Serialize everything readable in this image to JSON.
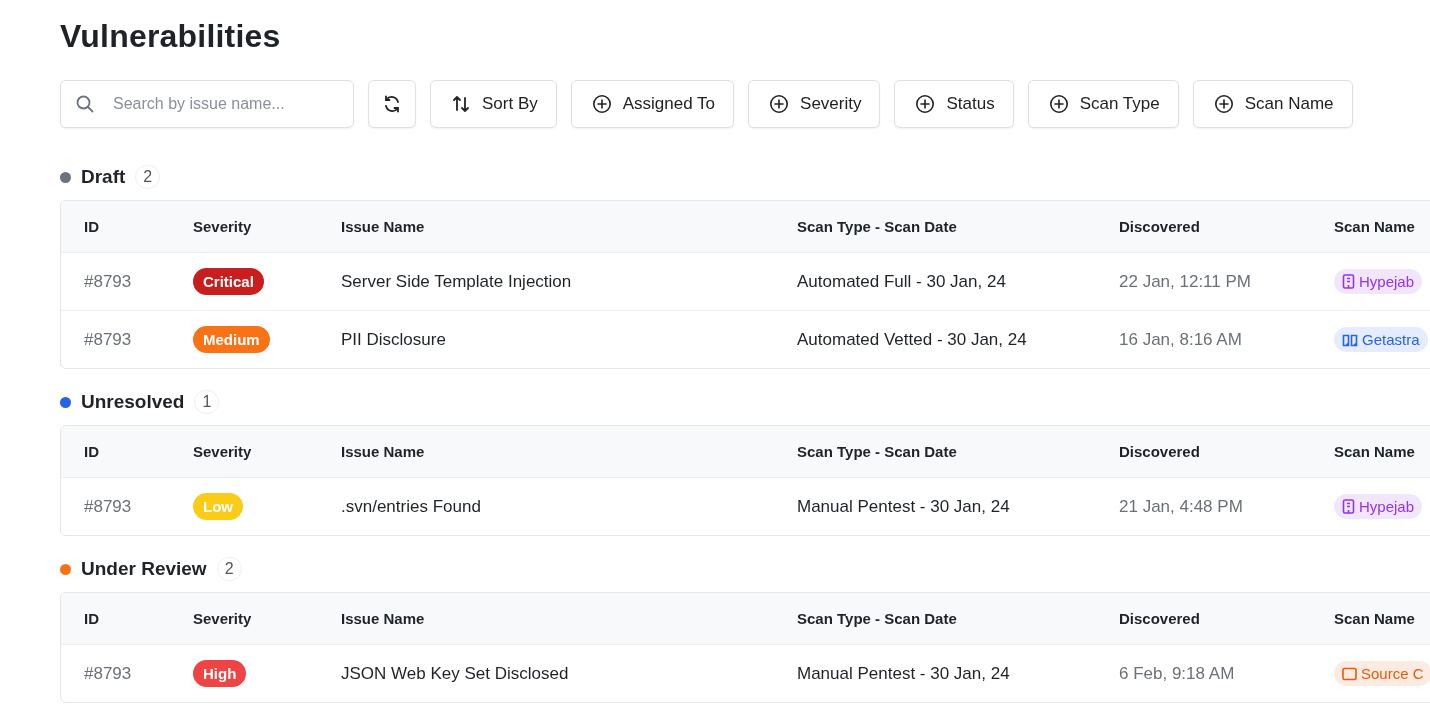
{
  "title": "Vulnerabilities",
  "search": {
    "placeholder": "Search by issue name..."
  },
  "filters": [
    {
      "kind": "sort",
      "label": "Sort By"
    },
    {
      "kind": "add",
      "label": "Assigned To"
    },
    {
      "kind": "add",
      "label": "Severity"
    },
    {
      "kind": "add",
      "label": "Status"
    },
    {
      "kind": "add",
      "label": "Scan Type"
    },
    {
      "kind": "add",
      "label": "Scan Name"
    }
  ],
  "groups": [
    {
      "name": "Draft",
      "count": "2",
      "color": "#6b7280",
      "columns": [
        "ID",
        "Severity",
        "Issue Name",
        "Scan Type - Scan Date",
        "Discovered",
        "Scan Name"
      ],
      "rows": [
        {
          "id": "#8793",
          "severity": {
            "label": "Critical",
            "color": "#c81e1e"
          },
          "issue": "Server Side Template Injection",
          "scan": "Automated Full - 30 Jan, 24",
          "discovered": "22 Jan, 12:11 PM",
          "scan_name": {
            "label": "Hypejab",
            "kind": "building",
            "color": "#9333ea"
          }
        },
        {
          "id": "#8793",
          "severity": {
            "label": "Medium",
            "color": "#f97316"
          },
          "issue": "PII Disclosure",
          "scan": "Automated Vetted - 30 Jan, 24",
          "discovered": "16 Jan, 8:16 AM",
          "scan_name": {
            "label": "Getastra",
            "kind": "cloud",
            "color": "#2563eb"
          }
        }
      ]
    },
    {
      "name": "Unresolved",
      "count": "1",
      "color": "#2563eb",
      "columns": [
        "ID",
        "Severity",
        "Issue Name",
        "Scan Type - Scan Date",
        "Discovered",
        "Scan Name"
      ],
      "rows": [
        {
          "id": "#8793",
          "severity": {
            "label": "Low",
            "color": "#facc15"
          },
          "issue": ".svn/entries Found",
          "scan": "Manual Pentest - 30 Jan, 24",
          "discovered": "21 Jan, 4:48 PM",
          "scan_name": {
            "label": "Hypejab",
            "kind": "building",
            "color": "#9333ea"
          }
        }
      ]
    },
    {
      "name": "Under Review",
      "count": "2",
      "color": "#f97316",
      "columns": [
        "ID",
        "Severity",
        "Issue Name",
        "Scan Type - Scan Date",
        "Discovered",
        "Scan Name"
      ],
      "rows": [
        {
          "id": "#8793",
          "severity": {
            "label": "High",
            "color": "#ef4444"
          },
          "issue": "JSON Web Key Set Disclosed",
          "scan": "Manual Pentest - 30 Jan, 24",
          "discovered": "6 Feb, 9:18 AM",
          "scan_name": {
            "label": "Source C",
            "kind": "window",
            "color": "#ea580c"
          }
        }
      ]
    }
  ]
}
